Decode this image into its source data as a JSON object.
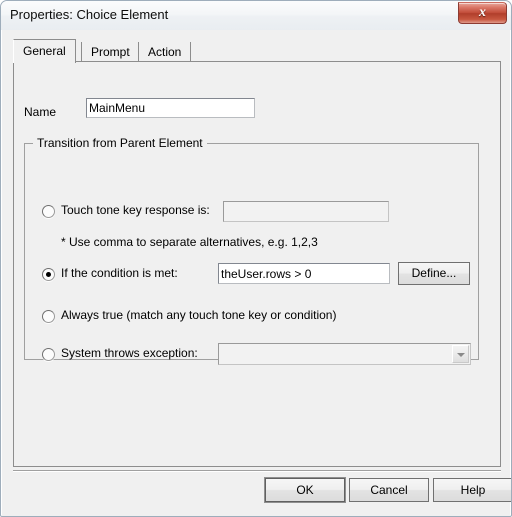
{
  "window": {
    "title": "Properties: Choice Element",
    "close_glyph": "x"
  },
  "tabs": [
    {
      "label": "General",
      "selected": true
    },
    {
      "label": "Prompt",
      "selected": false
    },
    {
      "label": "Action",
      "selected": false
    }
  ],
  "form": {
    "name_label": "Name",
    "name_value": "MainMenu",
    "name_placeholder": ""
  },
  "groupbox": {
    "title": "Transition from Parent Element",
    "hint": "* Use comma to separate alternatives, e.g. 1,2,3",
    "options": [
      {
        "label": "Touch tone key response is:",
        "checked": false,
        "field_value": "",
        "field_placeholder": ""
      },
      {
        "label": "If the condition is met:",
        "checked": true,
        "field_value": "theUser.rows > 0",
        "field_placeholder": "",
        "button_label": "Define..."
      },
      {
        "label": "Always true (match any touch tone key or condition)",
        "checked": false
      },
      {
        "label": "System throws exception:",
        "checked": false,
        "combo_value": "",
        "combo_arrow": "chevron-down-icon"
      }
    ]
  },
  "buttons": {
    "ok": "OK",
    "cancel": "Cancel",
    "help": "Help"
  },
  "colors": {
    "dialog_face": "#f0f0f0",
    "field_background": "#ffffff",
    "disabled_field": "#f2f2f2",
    "border": "#8d8d8d",
    "close_button_red": "#c14b38"
  }
}
